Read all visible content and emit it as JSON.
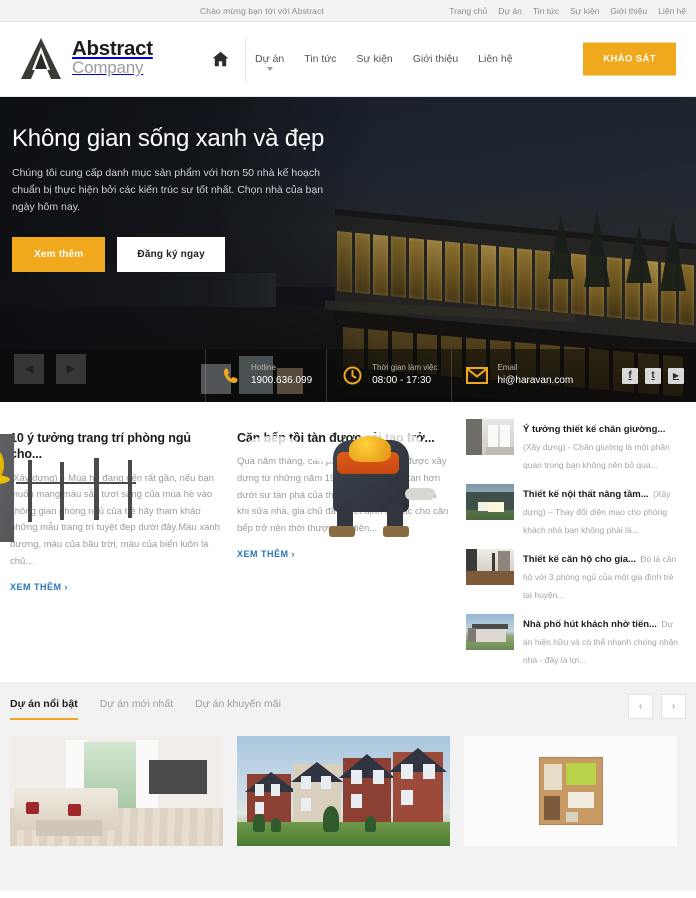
{
  "topbar": {
    "welcome": "Chào mừng bạn tới với Abstract",
    "links": [
      {
        "label": "Trang chủ"
      },
      {
        "label": "Dự án"
      },
      {
        "label": "Tin tức"
      },
      {
        "label": "Sự kiện"
      },
      {
        "label": "Giới thiệu"
      },
      {
        "label": "Liên hệ"
      }
    ]
  },
  "header": {
    "logo_name": "Abstract",
    "logo_sub": "Company",
    "home_icon": "home-icon",
    "nav": [
      {
        "label": "Dự án",
        "has_caret": true
      },
      {
        "label": "Tin tức",
        "has_caret": false
      },
      {
        "label": "Sự kiện",
        "has_caret": false
      },
      {
        "label": "Giới thiệu",
        "has_caret": false
      },
      {
        "label": "Liên hệ",
        "has_caret": false
      }
    ],
    "survey_button": "KHẢO SÁT"
  },
  "hero": {
    "title": "Không gian sống xanh và đẹp",
    "description": "Chúng tôi cung cấp danh mục sản phẩm với hơn 50 nhà kế hoạch chuẩn bị thực hiện bởi các kiến trúc sư tốt nhất. Chọn nhà của bạn ngày hôm nay.",
    "btn_primary": "Xem thêm",
    "btn_secondary": "Đăng ký ngay",
    "prev_icon": "chevron-left-icon",
    "next_icon": "chevron-right-icon",
    "contact": [
      {
        "icon": "phone-icon",
        "label": "Hotline",
        "value": "1900.636.099"
      },
      {
        "icon": "clock-icon",
        "label": "Thời gian làm việc",
        "value": "08:00 - 17:30"
      },
      {
        "icon": "mail-icon",
        "label": "Email",
        "value": "hi@haravan.com"
      }
    ],
    "socials": [
      {
        "name": "facebook-icon",
        "glyph": "f"
      },
      {
        "name": "twitter-icon",
        "glyph": "t"
      },
      {
        "name": "youtube-icon",
        "glyph": "▶"
      }
    ]
  },
  "news": {
    "featured": [
      {
        "image": "construction-interior-photo",
        "title": "10 ý tưởng trang trí phòng ngủ cho...",
        "excerpt": "(Xây dựng) – Mùa hè đang đến rất gần, nếu bạn muốn mang màu sắc tươi sáng của mùa hè vào không gian phòng ngủ của trẻ hãy tham khảo những mẫu trang trí tuyệt đẹp dưới đây.Màu xanh dương, màu của bầu trời, màu của biển luôn là chủ...",
        "readmore": "XEM THÊM"
      },
      {
        "image": "roof-worker-photo",
        "title": "Căn bếp tồi tàn được cải tạo trở...",
        "excerpt": "Qua năm tháng, căn phòng bếp cổ kính được xây dựng từ những năm 1906 đã trở nên tồi tàn hơn dưới sự tàn phá của thời gian. Chính vì vậy mà khi sửa nhà, gia chủ đã quyết định lột xác cho căn bếp trở nên thời thượng và tiện...",
        "readmore": "XEM THÊM"
      }
    ],
    "sidebar": [
      {
        "image": "bedroom-thumb",
        "title": "Ý tưởng thiết kế chân giường...",
        "excerpt": "(Xây dựng) - Chân giường là một phần quan trong bạn không nên bỏ qua..."
      },
      {
        "image": "field-house-thumb",
        "title": "Thiết kế nội thất nâng tầm...",
        "excerpt": "(Xây dựng) – Thay đổi diện mạo cho phòng khách nhà bạn không phải là..."
      },
      {
        "image": "hallway-thumb",
        "title": "Thiết kế căn hộ cho gia...",
        "excerpt": "Đó là căn hộ với 3 phòng ngủ của một gia đình trẻ tại huyện..."
      },
      {
        "image": "modern-house-thumb",
        "title": "Nhà phố hút khách nhờ tiến...",
        "excerpt": "Dự án hiện hữu và có thể nhanh chóng nhận nhà - đây là lợi..."
      }
    ]
  },
  "projects": {
    "tabs": [
      {
        "label": "Dự án nổi bật",
        "active": true
      },
      {
        "label": "Dự án mới nhất",
        "active": false
      },
      {
        "label": "Dự án khuyến mãi",
        "active": false
      }
    ],
    "prev_icon": "chevron-left-icon",
    "next_icon": "chevron-right-icon",
    "cards": [
      {
        "image": "living-room-photo"
      },
      {
        "image": "apartment-building-photo"
      },
      {
        "image": "floorplan-photo"
      }
    ]
  },
  "colors": {
    "accent": "#f0a81c",
    "link": "#2a77b5",
    "section_bg": "#f2f2f2",
    "muted_text": "#9b9b9b"
  }
}
